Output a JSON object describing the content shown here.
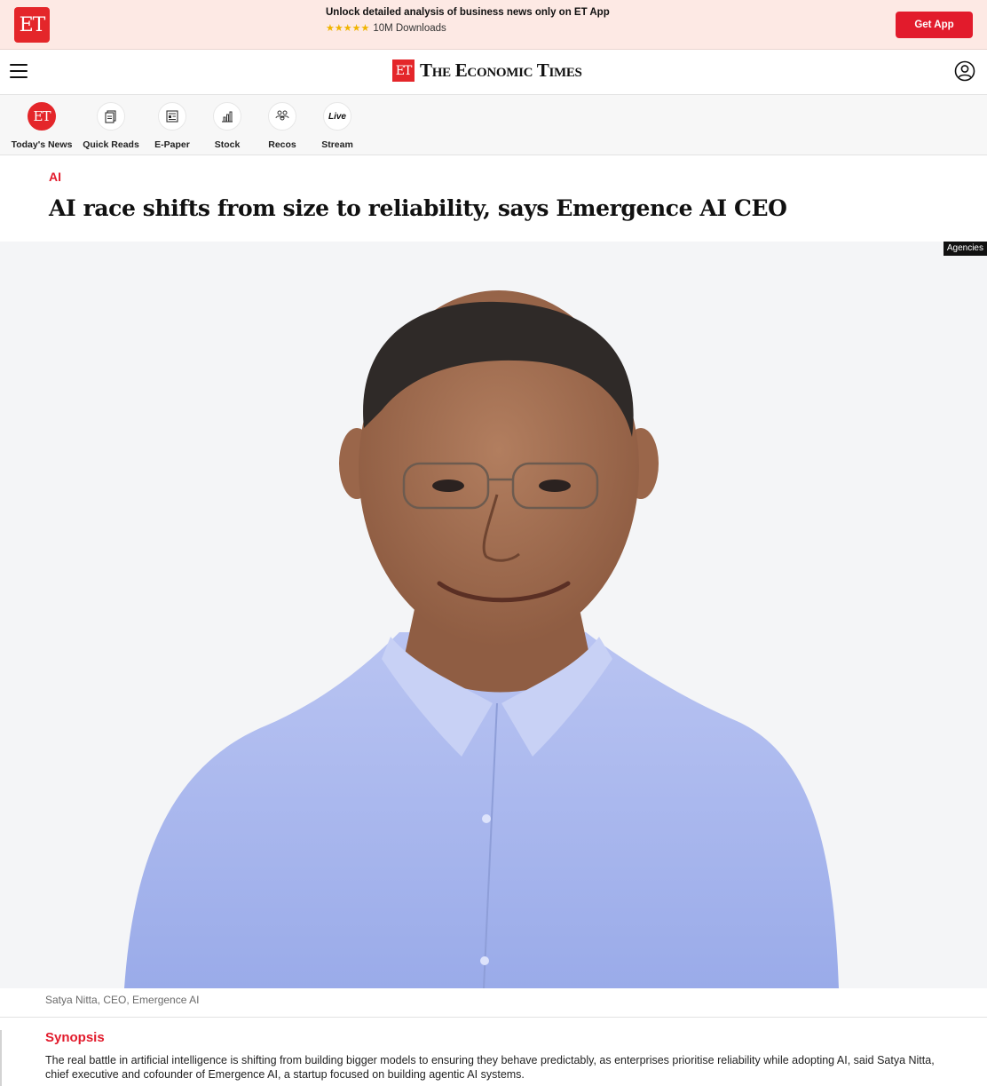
{
  "app_banner": {
    "logo_text": "ET",
    "headline": "Unlock detailed analysis of business news only on ET App",
    "stars": "★★★★★",
    "rating_count": 5,
    "downloads": "10M Downloads",
    "cta_label": "Get App"
  },
  "header": {
    "logo_text": "ET",
    "paper_name": "The Economic Times",
    "icons": [
      "hamburger-menu-icon",
      "user-account-icon"
    ]
  },
  "quick_nav": [
    {
      "label": "Today's News",
      "icon": "et-logo-icon"
    },
    {
      "label": "Quick Reads",
      "icon": "quick-reads-icon"
    },
    {
      "label": "E-Paper",
      "icon": "newspaper-icon"
    },
    {
      "label": "Stock",
      "icon": "stock-chart-icon"
    },
    {
      "label": "Recos",
      "icon": "recos-people-icon"
    },
    {
      "label": "Stream",
      "icon": "live-icon",
      "badge_text": "Live"
    }
  ],
  "article": {
    "section": "AI",
    "headline": "AI race shifts from size to reliability, says Emergence AI CEO",
    "image_credit": "Agencies",
    "image_caption": "Satya Nitta, CEO, Emergence AI",
    "synopsis_title": "Synopsis",
    "synopsis_text": "The real battle in artificial intelligence is shifting from building bigger models to ensuring they behave predictably, as enterprises prioritise reliability while adopting AI, said Satya Nitta, chief executive and cofounder of Emergence AI, a startup focused on building agentic AI systems."
  },
  "colors": {
    "brand_red": "#e21b2c",
    "banner_bg": "#fde9e4",
    "shirt_blue": "#a9b8ee"
  }
}
